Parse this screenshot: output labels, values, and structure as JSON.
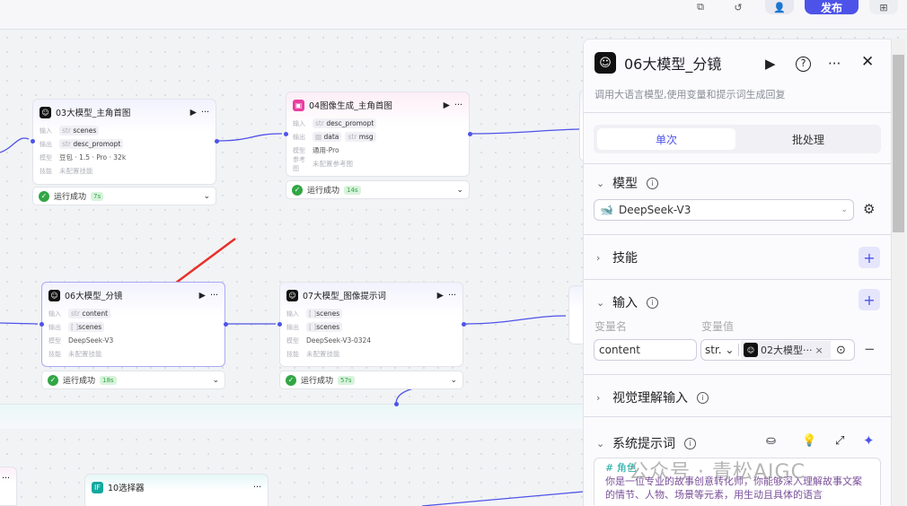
{
  "toolbar": {
    "publish_label": "发布",
    "icons": [
      "copy-icon",
      "history-icon",
      "user-icon",
      "add-page-icon"
    ],
    "accent": "#4d53e8"
  },
  "nodes": [
    {
      "title": "03大模型_主角首图",
      "input_label": "输入",
      "input": "scenes",
      "input_type": "str",
      "output_label": "输出",
      "output": "desc_promopt",
      "output_type": "str",
      "model_label": "模型",
      "model": "豆包 · 1.5 · Pro · 32k",
      "skill_label": "技能",
      "skill": "未配置技能",
      "status": "运行成功",
      "time": "7s"
    },
    {
      "title": "04图像生成_主角首图",
      "input_label": "输入",
      "input": "desc_promopt",
      "input_type": "str",
      "output_label": "输出",
      "outputs": [
        "data",
        "msg"
      ],
      "output_type2": "str",
      "model_label": "模型",
      "model": "通用-Pro",
      "ref_label": "参考图",
      "ref": "未配置参考图",
      "status": "运行成功",
      "time": "14s"
    },
    {
      "title": "06大模型_分镜",
      "input_label": "输入",
      "input": "content",
      "input_type": "str",
      "output_label": "输出",
      "output": "scenes",
      "output_type": "[ ]",
      "model_label": "模型",
      "model": "DeepSeek-V3",
      "skill_label": "技能",
      "skill": "未配置技能",
      "status": "运行成功",
      "time": "18s"
    },
    {
      "title": "07大模型_图像提示词",
      "input_label": "输入",
      "input": "scenes",
      "input_type": "[ ]",
      "output_label": "输出",
      "output": "scenes",
      "output_type": "[ ]",
      "model_label": "模型",
      "model": "DeepSeek-V3-0324",
      "skill_label": "技能",
      "skill": "未配置技能",
      "status": "运行成功",
      "time": "57s"
    },
    {
      "title": "10选择器",
      "icon": "IF"
    }
  ],
  "panel": {
    "title": "06大模型_分镜",
    "description": "调用大语言模型,使用变量和提示词生成回复",
    "tabs": [
      "单次",
      "批处理"
    ],
    "model_section": "模型",
    "model_value": "DeepSeek-V3",
    "skill_section": "技能",
    "input_section": "输入",
    "var_name_header": "变量名",
    "var_value_header": "变量值",
    "var_name": "content",
    "var_type": "str.",
    "var_ref": "02大模型···",
    "vision_section": "视觉理解输入",
    "system_prompt_section": "系统提示词",
    "prompt_heading": "# 角色",
    "prompt_text": "你是一位专业的故事创意转化师，你能够深入理解故事文案的情节、人物、场景等元素，用生动且具体的语言"
  },
  "watermark": "公众号 · 青松AIGC"
}
